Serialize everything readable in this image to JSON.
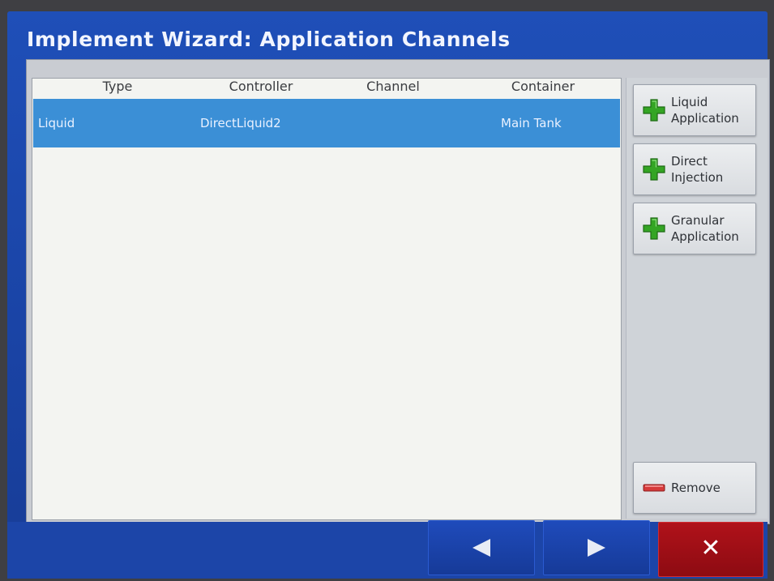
{
  "window": {
    "title": "Implement Wizard:  Application Channels"
  },
  "table": {
    "columns": [
      "Type",
      "Controller",
      "Channel",
      "Container"
    ],
    "rows": [
      {
        "type": "Liquid",
        "controller": "DirectLiquid2",
        "channel": "",
        "container": "Main Tank",
        "selected": true
      }
    ]
  },
  "actions": {
    "liquid_application": {
      "label_line1": "Liquid",
      "label_line2": "Application",
      "icon": "plus-icon"
    },
    "direct_injection": {
      "label_line1": "Direct",
      "label_line2": "Injection",
      "icon": "plus-icon"
    },
    "granular_application": {
      "label_line1": "Granular",
      "label_line2": "Application",
      "icon": "plus-icon"
    },
    "remove": {
      "label": "Remove",
      "icon": "minus-icon"
    }
  },
  "navigation": {
    "back_icon": "arrow-left-icon",
    "next_icon": "arrow-right-icon",
    "cancel_glyph": "✕",
    "cancel_icon": "close-icon"
  },
  "colors": {
    "title_bar": "#1f4fb8",
    "selected_row": "#3b8fd6",
    "add_icon": "#34a524",
    "remove_icon": "#d63a3a",
    "cancel_button": "#a3101a"
  }
}
